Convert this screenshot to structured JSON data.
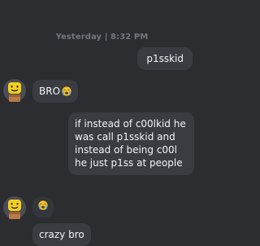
{
  "chat": {
    "timestamp": "Yesterday | 8:32 PM",
    "messages": [
      {
        "sender": "me",
        "text": "p1sskid"
      },
      {
        "sender": "other",
        "text": "BRO",
        "emoji": "loudly-crying-face-icon"
      },
      {
        "sender": "me",
        "text": "if instead of c00lkid he was call p1sskid and instead of being c00l he just p1ss at people"
      },
      {
        "sender": "other",
        "emoji": "loudly-crying-face-icon"
      },
      {
        "sender": "other",
        "text": "crazy bro"
      }
    ]
  },
  "colors": {
    "background": "#2b2d31",
    "bubble": "#3a3c42",
    "timestamp": "#72767d",
    "avatar_head": "#f6d01a"
  }
}
